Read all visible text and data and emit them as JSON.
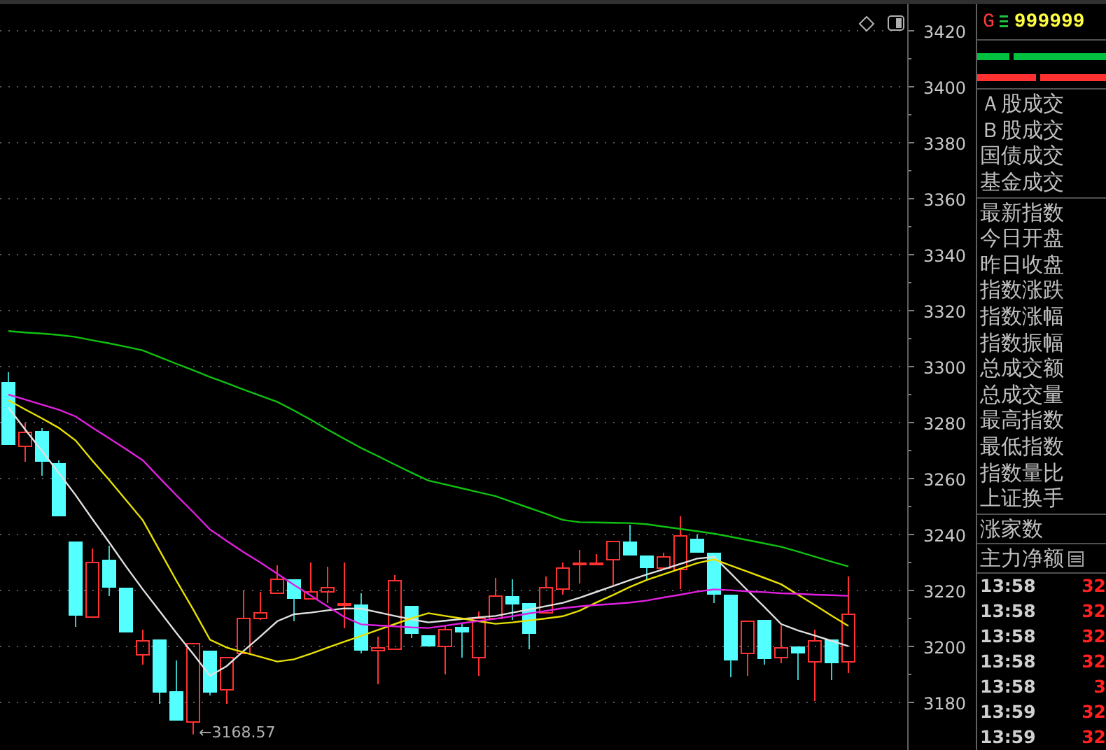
{
  "chart": {
    "chart_data": {
      "type": "candlestick",
      "grid": true,
      "ylim": [
        3163,
        3429.5
      ],
      "yticks": [
        3180,
        3200,
        3220,
        3240,
        3260,
        3280,
        3300,
        3320,
        3340,
        3360,
        3380,
        3400,
        3420
      ],
      "ohlc": [
        [
          3294.5,
          3298,
          3272,
          3272
        ],
        [
          3271.5,
          3280,
          3266,
          3276.5
        ],
        [
          3277,
          3278,
          3261,
          3266
        ],
        [
          3265.5,
          3266.5,
          3246.5,
          3246.5
        ],
        [
          3237.5,
          3237.5,
          3207,
          3211
        ],
        [
          3210.5,
          3235,
          3210.5,
          3230
        ],
        [
          3231,
          3236,
          3218,
          3221
        ],
        [
          3221,
          3221,
          3205,
          3205
        ],
        [
          3197,
          3206,
          3193.5,
          3202
        ],
        [
          3202.5,
          3202.5,
          3179.5,
          3183.5
        ],
        [
          3184,
          3195,
          3173.5,
          3173.5
        ],
        [
          3173,
          3201,
          3168.57,
          3201
        ],
        [
          3198.5,
          3198.5,
          3182.5,
          3183.5
        ],
        [
          3184.5,
          3196,
          3179.5,
          3196
        ],
        [
          3197.5,
          3220,
          3197.5,
          3210
        ],
        [
          3210,
          3219.5,
          3209.5,
          3212
        ],
        [
          3219,
          3229,
          3219,
          3224
        ],
        [
          3224,
          3224,
          3209,
          3217
        ],
        [
          3217,
          3230,
          3217,
          3219.5
        ],
        [
          3219.5,
          3228.5,
          3215.5,
          3221
        ],
        [
          3214.75,
          3230,
          3206.5,
          3215.25
        ],
        [
          3215,
          3219,
          3197.5,
          3198.5
        ],
        [
          3198.5,
          3203.5,
          3186.5,
          3199.5
        ],
        [
          3199,
          3225.5,
          3199,
          3223.5
        ],
        [
          3214.5,
          3214.5,
          3203,
          3204.5
        ],
        [
          3204,
          3204,
          3200,
          3200
        ],
        [
          3200,
          3207.5,
          3190,
          3206
        ],
        [
          3207,
          3208.5,
          3196,
          3205
        ],
        [
          3196,
          3212.5,
          3189.5,
          3210
        ],
        [
          3210,
          3224.5,
          3210,
          3218
        ],
        [
          3218,
          3224,
          3209.5,
          3215
        ],
        [
          3215.5,
          3215.5,
          3199,
          3204.5
        ],
        [
          3212,
          3225,
          3212,
          3221
        ],
        [
          3220.5,
          3230,
          3218.5,
          3228
        ],
        [
          3229.25,
          3234.5,
          3222.5,
          3229.75
        ],
        [
          3229.25,
          3233,
          3229,
          3229.75
        ],
        [
          3231,
          3237.5,
          3221.5,
          3237.5
        ],
        [
          3237.5,
          3243.5,
          3232.5,
          3232.5
        ],
        [
          3232.5,
          3232.5,
          3223.5,
          3228
        ],
        [
          3228,
          3233.5,
          3228,
          3232
        ],
        [
          3227.5,
          3246.5,
          3220.5,
          3239.5
        ],
        [
          3238.5,
          3240,
          3233.5,
          3233.5
        ],
        [
          3233.5,
          3233.5,
          3215.5,
          3218.5
        ],
        [
          3218.5,
          3218.5,
          3189,
          3195
        ],
        [
          3197.5,
          3209,
          3189.5,
          3209
        ],
        [
          3209.5,
          3209.5,
          3193.5,
          3195.5
        ],
        [
          3196,
          3207.5,
          3194,
          3199.5
        ],
        [
          3200,
          3200,
          3188,
          3197.5
        ],
        [
          3194.5,
          3206,
          3180.5,
          3202
        ],
        [
          3202.5,
          3202.5,
          3188,
          3194
        ],
        [
          3194.5,
          3225,
          3190.5,
          3211.5
        ],
        null,
        null,
        null
      ],
      "series": [
        {
          "type": "line",
          "color": "#e0e0e0",
          "values": [
            3285.4,
            3277.5,
            3269.9,
            3262,
            3254.1,
            3245.5,
            3237.2,
            3228.6,
            3220.4,
            3212.6,
            3204.8,
            3197.3,
            3189.5,
            3193,
            3198.4,
            3203.6,
            3209,
            3211.5,
            3212.1,
            3212.9,
            3213.6,
            3213.5,
            3212.2,
            3210.9,
            3209.7,
            3208.6,
            3209.2,
            3209.8,
            3210.4,
            3210.9,
            3212.1,
            3213.2,
            3214.4,
            3215.6,
            3217.4,
            3219.5,
            3221.6,
            3223.7,
            3225.7,
            3227.6,
            3229.5,
            3231.4,
            3232,
            3226.1,
            3220,
            3214.1,
            3208,
            3205.7,
            3203.9,
            3202,
            3200.1,
            null,
            null,
            null
          ]
        },
        {
          "type": "line",
          "color": "#e8e000",
          "values": [
            3288,
            3284.7,
            3281.5,
            3278.1,
            3273.6,
            3266.4,
            3259.5,
            3252.3,
            3245.1,
            3234.3,
            3223.5,
            3213.2,
            3202.4,
            3199.6,
            3197.9,
            3196.3,
            3194.6,
            3195.4,
            3197.4,
            3199.6,
            3201.7,
            3203.8,
            3205.9,
            3208,
            3210.1,
            3211.9,
            3210.9,
            3210,
            3209,
            3208.1,
            3208.6,
            3209.3,
            3210,
            3210.8,
            3212.8,
            3215.7,
            3218.4,
            3221.3,
            3223.8,
            3225.8,
            3227.8,
            3229.8,
            3231.1,
            3228.9,
            3226.7,
            3224.5,
            3222.2,
            3218.5,
            3214.8,
            3211,
            3207.3,
            null,
            null,
            null
          ]
        },
        {
          "type": "line",
          "color": "#e020e0",
          "values": [
            3290,
            3288.2,
            3286.4,
            3284.6,
            3282.2,
            3278.2,
            3274.4,
            3270.5,
            3266.5,
            3260.2,
            3254,
            3248,
            3241.8,
            3237.7,
            3233.7,
            3230,
            3226,
            3222,
            3218.2,
            3214.3,
            3210.5,
            3207.9,
            3207.5,
            3207.2,
            3206.8,
            3206.6,
            3207.4,
            3208.3,
            3209.1,
            3209.9,
            3210.8,
            3211.8,
            3212.7,
            3213.7,
            3214.3,
            3214.8,
            3215.2,
            3215.7,
            3216.4,
            3217.5,
            3218.5,
            3219.6,
            3220.4,
            3220.1,
            3219.7,
            3219.4,
            3219,
            3218.8,
            3218.5,
            3218.3,
            3218.1,
            null,
            null,
            null
          ]
        },
        {
          "type": "line",
          "color": "#10c010",
          "values": [
            3312.7,
            3312.2,
            3311.8,
            3311.3,
            3310.6,
            3309.4,
            3308.3,
            3307.1,
            3305.8,
            3303.4,
            3301,
            3298.7,
            3296.3,
            3294.1,
            3291.8,
            3289.6,
            3287.4,
            3284.3,
            3281,
            3277.5,
            3274.2,
            3270.9,
            3268,
            3265,
            3262.1,
            3259.3,
            3257.9,
            3256.5,
            3255.1,
            3253.7,
            3251.6,
            3249.5,
            3247.4,
            3245.2,
            3244.4,
            3244.3,
            3244.2,
            3244.1,
            3243.7,
            3242.8,
            3242,
            3241.2,
            3240.3,
            3239.2,
            3238,
            3236.8,
            3235.6,
            3233.9,
            3232.1,
            3230.3,
            3228.6,
            null,
            null,
            null
          ]
        }
      ],
      "annotations": [
        {
          "text": "←3168.57"
        }
      ]
    }
  },
  "panel": {
    "market_letter": "G",
    "code": "999999",
    "groups": [
      [
        "Ａ股成交",
        "Ｂ股成交",
        "国债成交",
        "基金成交"
      ],
      [
        "最新指数",
        "今日开盘",
        "昨日收盘",
        "指数涨跌",
        "指数涨幅",
        "指数振幅",
        "总成交额",
        "总成交量",
        "最高指数",
        "最低指数",
        "指数量比",
        "上证换手"
      ],
      [
        "涨家数"
      ]
    ],
    "flow_label": "主力净额",
    "ticks": [
      {
        "time": "13:58",
        "value": "32"
      },
      {
        "time": "13:58",
        "value": "32"
      },
      {
        "time": "13:58",
        "value": "32"
      },
      {
        "time": "13:58",
        "value": "32"
      },
      {
        "time": "13:58",
        "value": "3"
      },
      {
        "time": "13:59",
        "value": "32"
      },
      {
        "time": "13:59",
        "value": "32"
      }
    ]
  }
}
